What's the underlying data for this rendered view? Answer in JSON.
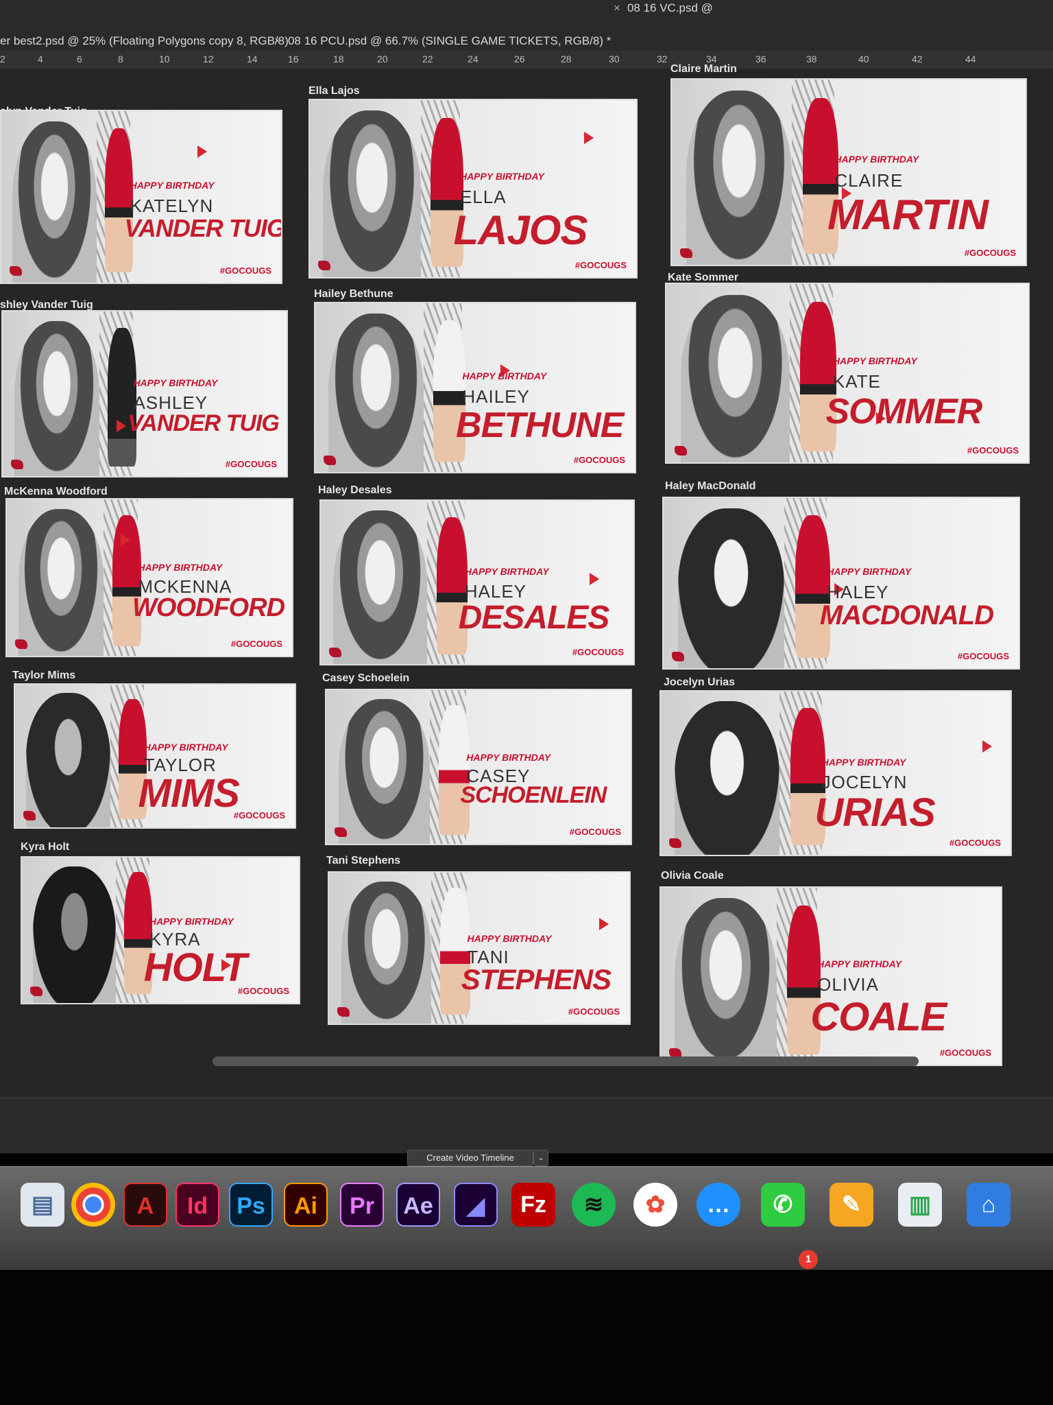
{
  "tabs": [
    {
      "label": "er best2.psd @ 25% (Floating Polygons copy 8, RGB/8)"
    },
    {
      "label": "08 16 PCU.psd @ 66.7% (SINGLE GAME TICKETS, RGB/8) *"
    },
    {
      "label": "08 16 VC.psd @"
    }
  ],
  "ruler": [
    "2",
    "4",
    "6",
    "8",
    "10",
    "12",
    "14",
    "16",
    "18",
    "20",
    "22",
    "24",
    "26",
    "28",
    "30",
    "32",
    "34",
    "36",
    "38",
    "40",
    "42",
    "44"
  ],
  "card_common": {
    "happy_birthday": "HAPPY BIRTHDAY",
    "hashtag": "#GOCOUGS"
  },
  "cards": [
    {
      "title": "elyn Vander Tuig",
      "first": "KATELYN",
      "last": "VANDER TUIG"
    },
    {
      "title": "Ella Lajos",
      "first": "ELLA",
      "last": "LAJOS"
    },
    {
      "title": "Claire Martin",
      "first": "CLAIRE",
      "last": "MARTIN"
    },
    {
      "title": "shley Vander Tuig",
      "first": "ASHLEY",
      "last": "VANDER TUIG"
    },
    {
      "title": "Hailey Bethune",
      "first": "HAILEY",
      "last": "BETHUNE"
    },
    {
      "title": "Kate Sommer",
      "first": "KATE",
      "last": "SOMMER"
    },
    {
      "title": "McKenna Woodford",
      "first": "MCKENNA",
      "last": "WOODFORD"
    },
    {
      "title": "Haley Desales",
      "first": "HALEY",
      "last": "DESALES"
    },
    {
      "title": "Haley MacDonald",
      "first": "HALEY",
      "last": "MACDONALD"
    },
    {
      "title": "Taylor Mims",
      "first": "TAYLOR",
      "last": "MIMS"
    },
    {
      "title": "Casey Schoelein",
      "first": "CASEY",
      "last": "SCHOENLEIN"
    },
    {
      "title": "Jocelyn Urias",
      "first": "JOCELYN",
      "last": "URIAS"
    },
    {
      "title": "Kyra Holt",
      "first": "KYRA",
      "last": "HOLT"
    },
    {
      "title": "Tani Stephens",
      "first": "TANI",
      "last": "STEPHENS"
    },
    {
      "title": "Olivia Coale",
      "first": "OLIVIA",
      "last": "COALE"
    }
  ],
  "timeline": {
    "button_label": "Create Video Timeline",
    "dropdown": "⌄"
  },
  "dock": {
    "apps": [
      {
        "icon": "preview-icon",
        "glyph": "▤"
      },
      {
        "icon": "chrome-icon",
        "glyph": "◉"
      },
      {
        "icon": "acrobat-icon",
        "glyph": "A"
      },
      {
        "icon": "indesign-icon",
        "glyph": "Id"
      },
      {
        "icon": "photoshop-icon",
        "glyph": "Ps"
      },
      {
        "icon": "illustrator-icon",
        "glyph": "Ai"
      },
      {
        "icon": "premiere-icon",
        "glyph": "Pr"
      },
      {
        "icon": "after-effects-icon",
        "glyph": "Ae"
      },
      {
        "icon": "media-encoder-icon",
        "glyph": "◢"
      },
      {
        "icon": "filezilla-icon",
        "glyph": "Fz"
      },
      {
        "icon": "spotify-icon",
        "glyph": "≋"
      },
      {
        "icon": "photos-icon",
        "glyph": "✿"
      },
      {
        "icon": "messages-icon",
        "glyph": "…"
      },
      {
        "icon": "facetime-icon",
        "glyph": "✆"
      },
      {
        "icon": "pages-icon",
        "glyph": "✎"
      },
      {
        "icon": "numbers-icon",
        "glyph": "▥"
      },
      {
        "icon": "keynote-icon",
        "glyph": "⌂"
      }
    ],
    "facetime_badge": "1"
  },
  "colors": {
    "brand_red": "#c41d2c",
    "canvas": "#262626"
  }
}
